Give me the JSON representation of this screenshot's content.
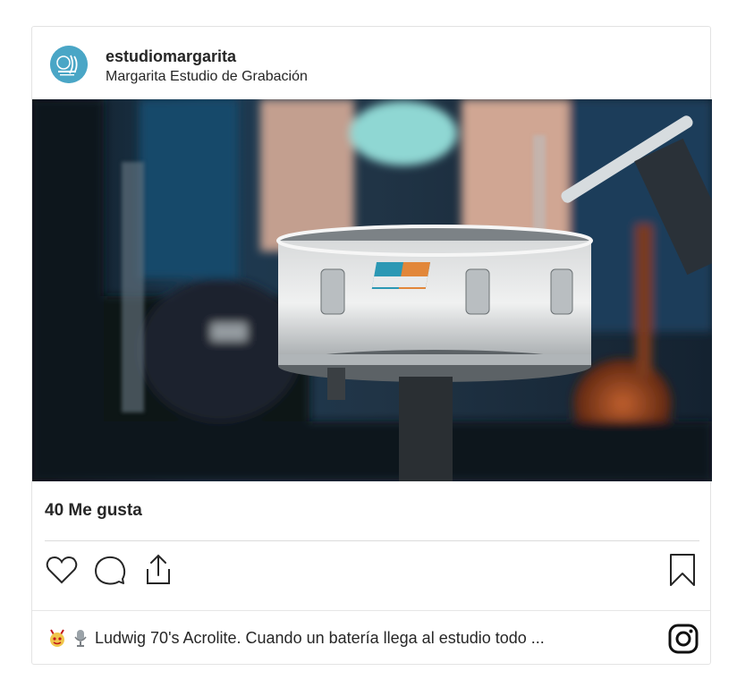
{
  "post": {
    "username": "estudiomargarita",
    "subtitle": "Margarita Estudio de Grabación",
    "likes": "40 Me gusta",
    "caption_text": "Ludwig 70's Acrolite. Cuando un batería llega al estudio todo ...",
    "caption_emojis": [
      "devil-face-emoji",
      "microphone-emoji"
    ],
    "image": {
      "description_icon": "snare-drum-photo",
      "drum_brand_badge": "Ludwig"
    }
  },
  "actions": [
    "heart-icon",
    "comment-icon",
    "share-icon",
    "bookmark-icon"
  ],
  "brand": {
    "platform_icon": "instagram-icon",
    "accent": "#4aa6c6"
  }
}
